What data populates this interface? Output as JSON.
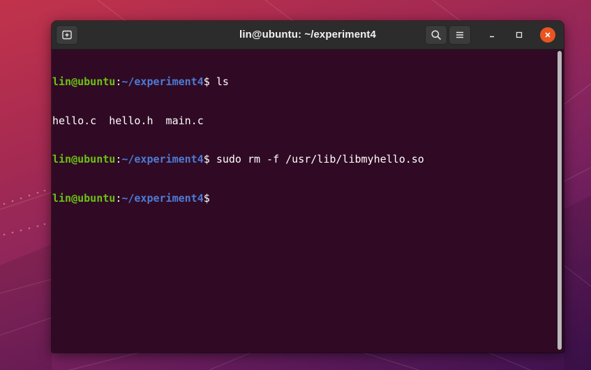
{
  "window": {
    "title": "lin@ubuntu: ~/experiment4"
  },
  "icons": {
    "new_tab": "new-tab-icon",
    "search": "search-icon",
    "menu": "hamburger-menu-icon",
    "minimize": "minimize-icon",
    "maximize": "maximize-icon",
    "close": "close-icon"
  },
  "colors": {
    "terminal_bg": "#300a24",
    "user_host": "#6bc215",
    "path": "#4d7bd6",
    "close_button": "#e95420",
    "titlebar": "#2c2c2c"
  },
  "terminal": {
    "prompt_user": "lin@ubuntu",
    "prompt_colon": ":",
    "prompt_path": "~/experiment4",
    "prompt_symbol": "$ ",
    "lines": [
      {
        "type": "prompt",
        "command": "ls"
      },
      {
        "type": "output",
        "text": "hello.c  hello.h  main.c"
      },
      {
        "type": "prompt",
        "command": "sudo rm -f /usr/lib/libmyhello.so"
      },
      {
        "type": "prompt",
        "command": ""
      }
    ]
  }
}
